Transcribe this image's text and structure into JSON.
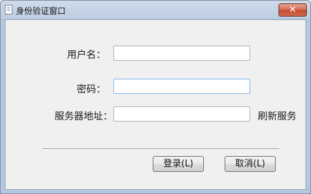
{
  "window": {
    "title": "身份验证窗口",
    "icon": "document-icon",
    "close_symbol": "✕"
  },
  "form": {
    "username_label": "用户名：",
    "username_value": "",
    "password_label": "密码：",
    "password_value": "",
    "server_label": "服务器地址：",
    "server_value": "",
    "refresh_label": "刷新服务"
  },
  "buttons": {
    "login_label": "登录(L)",
    "cancel_label": "取消(L)"
  },
  "colors": {
    "titlebar": "#bdcfe3",
    "close_button": "#c24a30",
    "focus_border": "#7eb4ea"
  }
}
